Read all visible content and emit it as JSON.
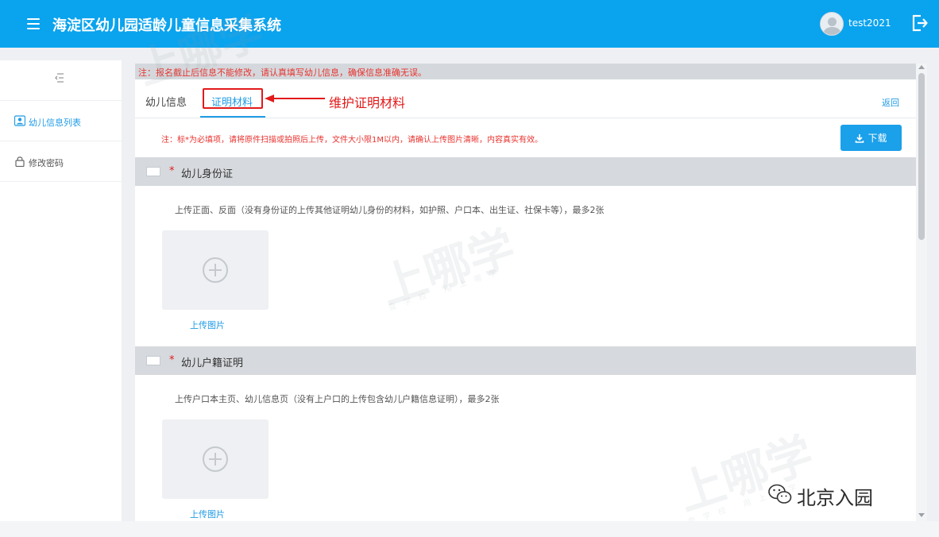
{
  "header": {
    "title": "海淀区幼儿园适龄儿童信息采集系统",
    "username": "test2021"
  },
  "sidebar": {
    "items": [
      {
        "label": "幼儿信息列表",
        "icon": "user-card-icon",
        "active": true
      },
      {
        "label": "修改密码",
        "icon": "lock-icon",
        "active": false
      }
    ]
  },
  "main": {
    "top_notice": "注：报名截止后信息不能修改，请认真填写幼儿信息，确保信息准确无误。",
    "tabs": [
      {
        "label": "幼儿信息"
      },
      {
        "label": "证明材料"
      }
    ],
    "annotation": "维护证明材料",
    "back_label": "返回",
    "note": "注：标*为必填项，请将原件扫描或拍照后上传，文件大小限1M以内，请确认上传图片清晰，内容真实有效。",
    "download_label": "下载",
    "sections": [
      {
        "title": "幼儿身份证",
        "required_mark": "*",
        "description": "上传正面、反面（没有身份证的上传其他证明幼儿身份的材料，如护照、户口本、出生证、社保卡等），最多2张",
        "upload_label": "上传图片"
      },
      {
        "title": "幼儿户籍证明",
        "required_mark": "*",
        "description": "上传户口本主页、幼儿信息页（没有上户口的上传包含幼儿户籍信息证明），最多2张",
        "upload_label": "上传图片"
      }
    ]
  },
  "watermark": {
    "text": "上哪学",
    "subtext": "查学校 用上哪学"
  },
  "badge": {
    "text": "北京入园"
  },
  "colors": {
    "header_bg": "#0aa3ee",
    "accent": "#1f9be6",
    "warning": "#e8332f",
    "annotation": "#e21a1a"
  }
}
